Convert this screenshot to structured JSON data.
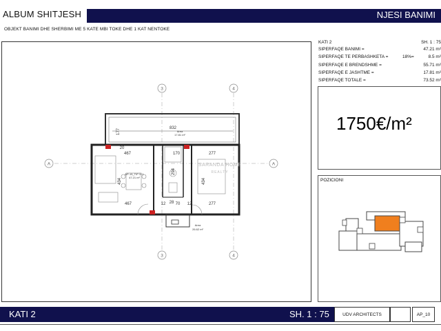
{
  "header": {
    "album_title": "ALBUM SHITJESH",
    "unit_title": "NJESI BANIMI",
    "subtitle": "OBJEKT BANIMI DHE SHERBIMI ME 5 KATE MBI TOKE DHE 1 KAT NENTOKE"
  },
  "info": {
    "floor": "KATI 2",
    "scale": "SH. 1 : 75",
    "rows": [
      {
        "label": "SIPERFAQE BANIMI =",
        "mid": "",
        "value": "47.21 m²"
      },
      {
        "label": "SIPERFAQE TE PERBASHKETA =",
        "mid": "18%=",
        "value": "8.5 m²"
      },
      {
        "label": "SIPERFAQE E BRENDSHME =",
        "mid": "",
        "value": "55.71 m²"
      },
      {
        "label": "SIPERFAQE E JASHTME =",
        "mid": "",
        "value": "17.81 m²"
      },
      {
        "label": "SIPERFAQE TOTALE =",
        "mid": "",
        "value": "73.52 m²"
      }
    ]
  },
  "price": "1750€/m²",
  "position": {
    "label": "POZICIONI",
    "highlight_color": "#f07f1e"
  },
  "plan": {
    "grid_labels": {
      "col_left": "3",
      "col_right": "4",
      "row": "A"
    },
    "dims": {
      "balcony_width": "832",
      "balcony_depth": "177",
      "left_top": "467",
      "left_bottom": "467",
      "right_top": "277",
      "right_bottom": "277",
      "middle_top": "170",
      "height_left": "434",
      "height_right": "434",
      "bath": "294",
      "bottom_a": "12",
      "bottom_b": "70",
      "bottom_c": "12",
      "bottom_d": "28",
      "small_20": "20"
    },
    "balcony_area_label": "Area",
    "balcony_area_value": "17.81 m²",
    "apartment_label": "AP-15_TIP 3+1",
    "apartment_area": "47.21 m²",
    "corridor_area_label": "Area",
    "corridor_area_value": "26.62 m²",
    "watermark_line1": "SARANDA HOME",
    "watermark_line2": "REALTY"
  },
  "footer": {
    "floor": "KATI 2",
    "scale": "SH. 1 : 75",
    "architect": "UDV ARCHITECTS",
    "sheet": "AP_10"
  }
}
